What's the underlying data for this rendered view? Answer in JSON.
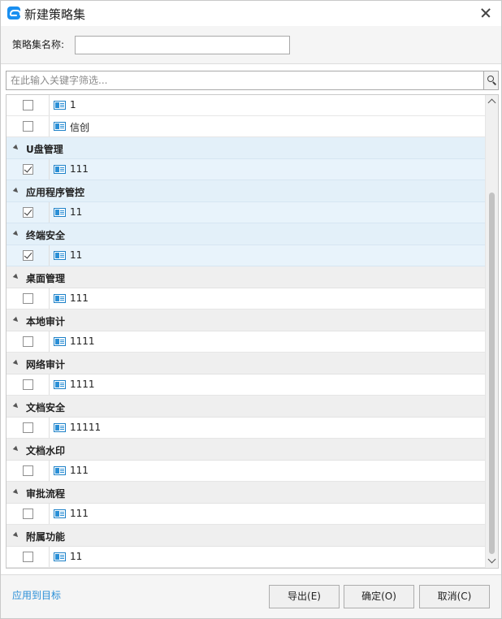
{
  "window": {
    "title": "新建策略集"
  },
  "name_field": {
    "label": "策略集名称:",
    "value": ""
  },
  "filter": {
    "placeholder": "在此输入关键字筛选..."
  },
  "list": {
    "rows": [
      {
        "kind": "item",
        "label": "1",
        "checked": false,
        "selected": false
      },
      {
        "kind": "item",
        "label": "信创",
        "checked": false,
        "selected": false
      },
      {
        "kind": "group",
        "label": "U盘管理",
        "selected": true
      },
      {
        "kind": "item",
        "label": "111",
        "checked": true,
        "selected": true
      },
      {
        "kind": "group",
        "label": "应用程序管控",
        "selected": true
      },
      {
        "kind": "item",
        "label": "11",
        "checked": true,
        "selected": true
      },
      {
        "kind": "group",
        "label": "终端安全",
        "selected": true
      },
      {
        "kind": "item",
        "label": "11",
        "checked": true,
        "selected": true
      },
      {
        "kind": "group",
        "label": "桌面管理",
        "selected": false
      },
      {
        "kind": "item",
        "label": "111",
        "checked": false,
        "selected": false
      },
      {
        "kind": "group",
        "label": "本地审计",
        "selected": false
      },
      {
        "kind": "item",
        "label": "1111",
        "checked": false,
        "selected": false
      },
      {
        "kind": "group",
        "label": "网络审计",
        "selected": false
      },
      {
        "kind": "item",
        "label": "1111",
        "checked": false,
        "selected": false
      },
      {
        "kind": "group",
        "label": "文档安全",
        "selected": false
      },
      {
        "kind": "item",
        "label": "11111",
        "checked": false,
        "selected": false
      },
      {
        "kind": "group",
        "label": "文档水印",
        "selected": false
      },
      {
        "kind": "item",
        "label": "111",
        "checked": false,
        "selected": false
      },
      {
        "kind": "group",
        "label": "审批流程",
        "selected": false
      },
      {
        "kind": "item",
        "label": "111",
        "checked": false,
        "selected": false
      },
      {
        "kind": "group",
        "label": "附属功能",
        "selected": false
      },
      {
        "kind": "item",
        "label": "11",
        "checked": false,
        "selected": false
      }
    ]
  },
  "footer": {
    "apply_link": "应用到目标",
    "export_label": "导出(E)",
    "ok_label": "确定(O)",
    "cancel_label": "取消(C)"
  },
  "colors": {
    "accent": "#2b8fd8",
    "selection": "#e8f3fb",
    "group_bg": "#efefef"
  }
}
